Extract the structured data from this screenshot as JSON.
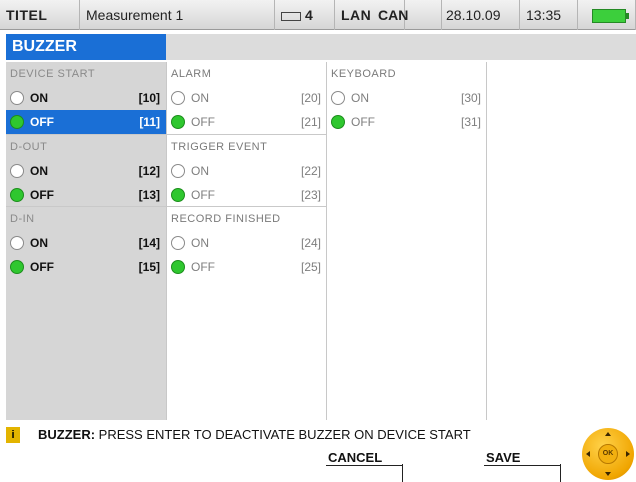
{
  "statusbar": {
    "titel": "TITEL",
    "measurement": "Measurement 1",
    "battery_count": "4",
    "lan": "LAN USB",
    "can": "CAN",
    "date": "28.10.09",
    "time": "13:35",
    "battery_level": 1.0
  },
  "page_title": "BUZZER",
  "columns": [
    {
      "groups": [
        {
          "label": "DEVICE START",
          "options": [
            {
              "label": "ON",
              "code": "[10]",
              "checked": false,
              "selected": false
            },
            {
              "label": "OFF",
              "code": "[11]",
              "checked": true,
              "selected": true
            }
          ]
        },
        {
          "label": "D-OUT",
          "options": [
            {
              "label": "ON",
              "code": "[12]",
              "checked": false,
              "selected": false
            },
            {
              "label": "OFF",
              "code": "[13]",
              "checked": true,
              "selected": false
            }
          ]
        },
        {
          "label": "D-IN",
          "options": [
            {
              "label": "ON",
              "code": "[14]",
              "checked": false,
              "selected": false
            },
            {
              "label": "OFF",
              "code": "[15]",
              "checked": true,
              "selected": false
            }
          ]
        }
      ]
    },
    {
      "groups": [
        {
          "label": "ALARM",
          "options": [
            {
              "label": "ON",
              "code": "[20]",
              "checked": false,
              "selected": false
            },
            {
              "label": "OFF",
              "code": "[21]",
              "checked": true,
              "selected": false
            }
          ]
        },
        {
          "label": "TRIGGER EVENT",
          "options": [
            {
              "label": "ON",
              "code": "[22]",
              "checked": false,
              "selected": false
            },
            {
              "label": "OFF",
              "code": "[23]",
              "checked": true,
              "selected": false
            }
          ]
        },
        {
          "label": "RECORD FINISHED",
          "options": [
            {
              "label": "ON",
              "code": "[24]",
              "checked": false,
              "selected": false
            },
            {
              "label": "OFF",
              "code": "[25]",
              "checked": true,
              "selected": false
            }
          ]
        }
      ]
    },
    {
      "groups": [
        {
          "label": "KEYBOARD",
          "options": [
            {
              "label": "ON",
              "code": "[30]",
              "checked": false,
              "selected": false
            },
            {
              "label": "OFF",
              "code": "[31]",
              "checked": true,
              "selected": false
            }
          ]
        }
      ]
    }
  ],
  "info": {
    "icon": "info-icon",
    "icon_text": "i",
    "prefix": "BUZZER:",
    "message": " PRESS ENTER TO DEACTIVATE BUZZER ON DEVICE START"
  },
  "softkeys": {
    "cancel": "CANCEL",
    "save": "SAVE"
  },
  "okwheel": {
    "label": "OK"
  },
  "colors": {
    "accent": "#1a6fd6",
    "radio_on": "#2fc72f",
    "panel_gray": "#d6d6d6",
    "info_icon": "#e3b400"
  }
}
